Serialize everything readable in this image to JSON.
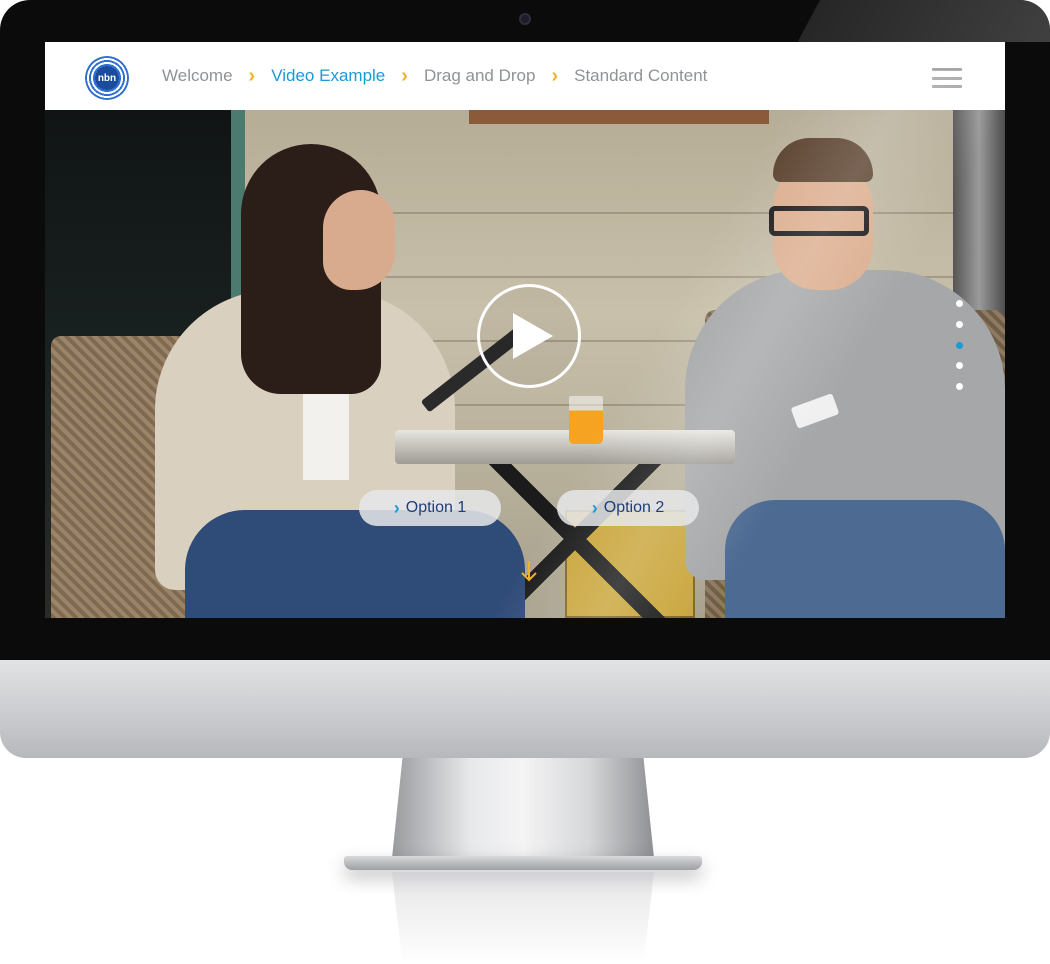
{
  "brand": {
    "logo_text": "nbn"
  },
  "breadcrumb": {
    "items": [
      {
        "label": "Welcome",
        "active": false
      },
      {
        "label": "Video Example",
        "active": true
      },
      {
        "label": "Drag and Drop",
        "active": false
      },
      {
        "label": "Standard Content",
        "active": false
      }
    ],
    "separator": "›"
  },
  "hero": {
    "options": [
      {
        "label": "Option 1"
      },
      {
        "label": "Option 2"
      }
    ],
    "pagination": {
      "count": 5,
      "active_index": 2
    },
    "play_icon": "play-icon",
    "scroll_icon": "arrow-down-icon"
  },
  "colors": {
    "accent_blue": "#1a9ad6",
    "accent_yellow": "#f0b323",
    "crumb_grey": "#8f9396",
    "option_text": "#1d3f7a"
  }
}
